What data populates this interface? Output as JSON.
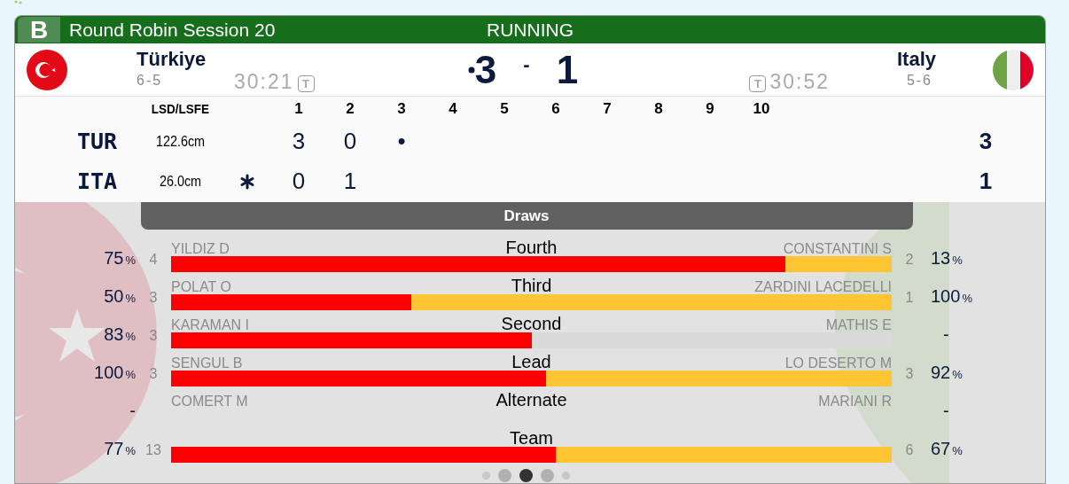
{
  "header": {
    "sheet": "B",
    "title": "Round Robin Session 20",
    "status": "RUNNING"
  },
  "teams": [
    {
      "name": "Türkiye",
      "record": "6-5",
      "time": "30:21",
      "timeout_label": "T",
      "score": "3",
      "score_marker": true,
      "kind": "turkey"
    },
    {
      "name": "Italy",
      "record": "5-6",
      "time": "30:52",
      "timeout_label": "T",
      "score": "1",
      "score_marker": false,
      "kind": "italy"
    }
  ],
  "score_separator": "-",
  "linescore": {
    "lsd_heading": "LSD/LSFE",
    "ends": [
      "1",
      "2",
      "3",
      "4",
      "5",
      "6",
      "7",
      "8",
      "9",
      "10"
    ],
    "rows": [
      {
        "team": "TUR",
        "lsd": "122.6cm",
        "hammer": false,
        "ends": [
          "3",
          "0",
          "•"
        ],
        "total": "3"
      },
      {
        "team": "ITA",
        "lsd": "26.0cm",
        "hammer": true,
        "ends": [
          "0",
          "1"
        ],
        "total": "1"
      }
    ]
  },
  "draws": {
    "title": "Draws",
    "rows": [
      {
        "position": "Fourth",
        "left_name": "YILDIZ D",
        "left_count": "4",
        "left_pct": "75",
        "left_unit": "%",
        "right_name": "CONSTANTINI S",
        "right_count": "2",
        "right_pct": "13",
        "right_unit": "%",
        "bar": {
          "level": 0.852,
          "opponent_share": true
        }
      },
      {
        "position": "Third",
        "left_name": "POLAT O",
        "left_count": "3",
        "left_pct": "50",
        "left_unit": "%",
        "right_name": "ZARDINI LACEDELLI",
        "right_count": "1",
        "right_pct": "100",
        "right_unit": "%",
        "bar": {
          "level": 0.333,
          "opponent_share": true
        }
      },
      {
        "position": "Second",
        "left_name": "KARAMAN I",
        "left_count": "3",
        "left_pct": "83",
        "left_unit": "%",
        "right_name": "MATHIS E",
        "right_pct": "-",
        "bar": {
          "level": 0.5,
          "opponent_share": false
        }
      },
      {
        "position": "Lead",
        "left_name": "SENGUL B",
        "left_count": "3",
        "left_pct": "100",
        "left_unit": "%",
        "right_name": "LO DESERTO M",
        "right_count": "3",
        "right_pct": "92",
        "right_unit": "%",
        "bar": {
          "level": 0.52,
          "opponent_share": true
        }
      },
      {
        "position": "Alternate",
        "left_name": "COMERT M",
        "left_pct": "-",
        "right_name": "MARIANI R",
        "right_pct": "-"
      },
      {
        "position": "Team",
        "left_count": "13",
        "left_pct": "77",
        "left_unit": "%",
        "right_count": "6",
        "right_pct": "67",
        "right_unit": "%",
        "bar": {
          "level": 0.534,
          "opponent_share": true
        }
      }
    ]
  },
  "pager": [
    {
      "selected": false
    },
    {
      "selected": false
    },
    {
      "selected": true
    },
    {
      "selected": false
    },
    {
      "selected": false
    }
  ]
}
